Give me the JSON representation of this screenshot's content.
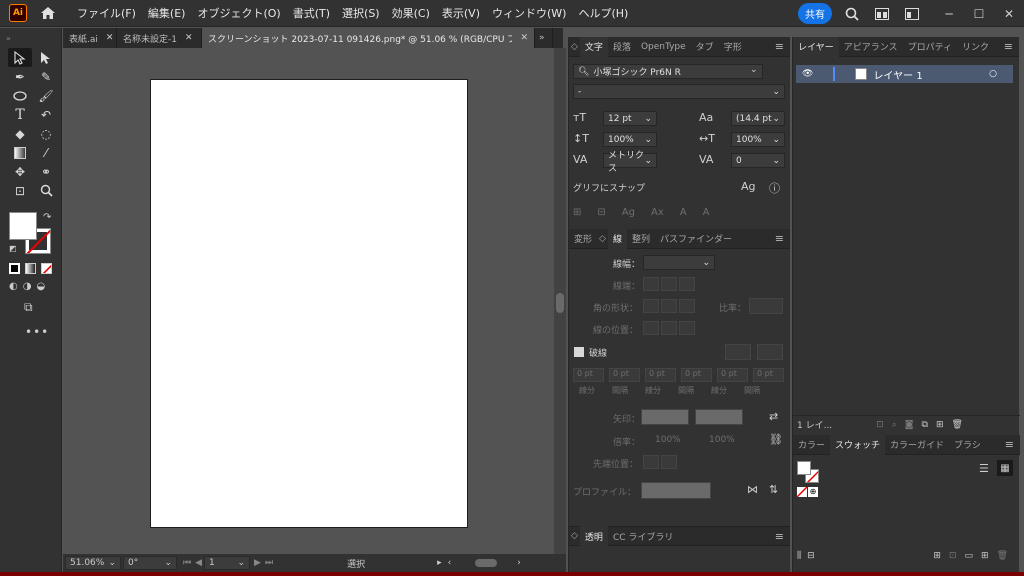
{
  "app": {
    "logo": "Ai"
  },
  "menu": [
    "ファイル(F)",
    "編集(E)",
    "オブジェクト(O)",
    "書式(T)",
    "選択(S)",
    "効果(C)",
    "表示(V)",
    "ウィンドウ(W)",
    "ヘルプ(H)"
  ],
  "menu_right": {
    "share": "共有"
  },
  "doc_tabs": [
    {
      "label": "表紙.ai"
    },
    {
      "label": "名称未設定-1"
    },
    {
      "label": "スクリーンショット 2023-07-11 091426.png* @ 51.06 % (RGB/CPU プレビュー)"
    }
  ],
  "status": {
    "zoom": "51.06%",
    "rotation": "0°",
    "page": "1",
    "tool": "選択"
  },
  "char_panel": {
    "tabs": [
      "文字",
      "段落",
      "OpenType",
      "タブ",
      "字形"
    ],
    "font": "小塚ゴシック Pr6N R",
    "style": "-",
    "size": "12 pt",
    "leading": "(14.4 pt",
    "vscale": "100%",
    "hscale": "100%",
    "kerning": "メトリクス",
    "tracking": "0",
    "snap_label": "グリフにスナップ"
  },
  "stroke_panel": {
    "tabs": [
      "変形",
      "線",
      "整列",
      "パスファインダー"
    ],
    "weight_label": "線幅：",
    "cap_label": "線端：",
    "corner_label": "角の形状：",
    "limit_label": "比率：",
    "align_label": "線の位置：",
    "dashed_label": "破線",
    "dash_values": [
      "0 pt",
      "0 pt",
      "0 pt",
      "0 pt",
      "0 pt",
      "0 pt"
    ],
    "dash_labels": [
      "線分",
      "間隔",
      "線分",
      "間隔",
      "線分",
      "間隔"
    ],
    "arrow_label": "矢印：",
    "scale_label": "倍率：",
    "scale_a": "100%",
    "scale_b": "100%",
    "tip_label": "先端位置：",
    "profile_label": "プロファイル："
  },
  "bottom_tabs": [
    "透明",
    "CC ライブラリ"
  ],
  "layers_panel": {
    "tabs": [
      "レイヤー",
      "アピアランス",
      "プロパティ",
      "リンク"
    ],
    "layer_name": "レイヤー 1",
    "footer": "1 レイ..."
  },
  "swatch_panel": {
    "tabs": [
      "カラー",
      "スウォッチ",
      "カラーガイド",
      "ブラシ"
    ]
  },
  "colors": {
    "accent": "#1473e6",
    "layer_highlight": "#4b5a71",
    "logo_orange": "#ff9a00"
  }
}
